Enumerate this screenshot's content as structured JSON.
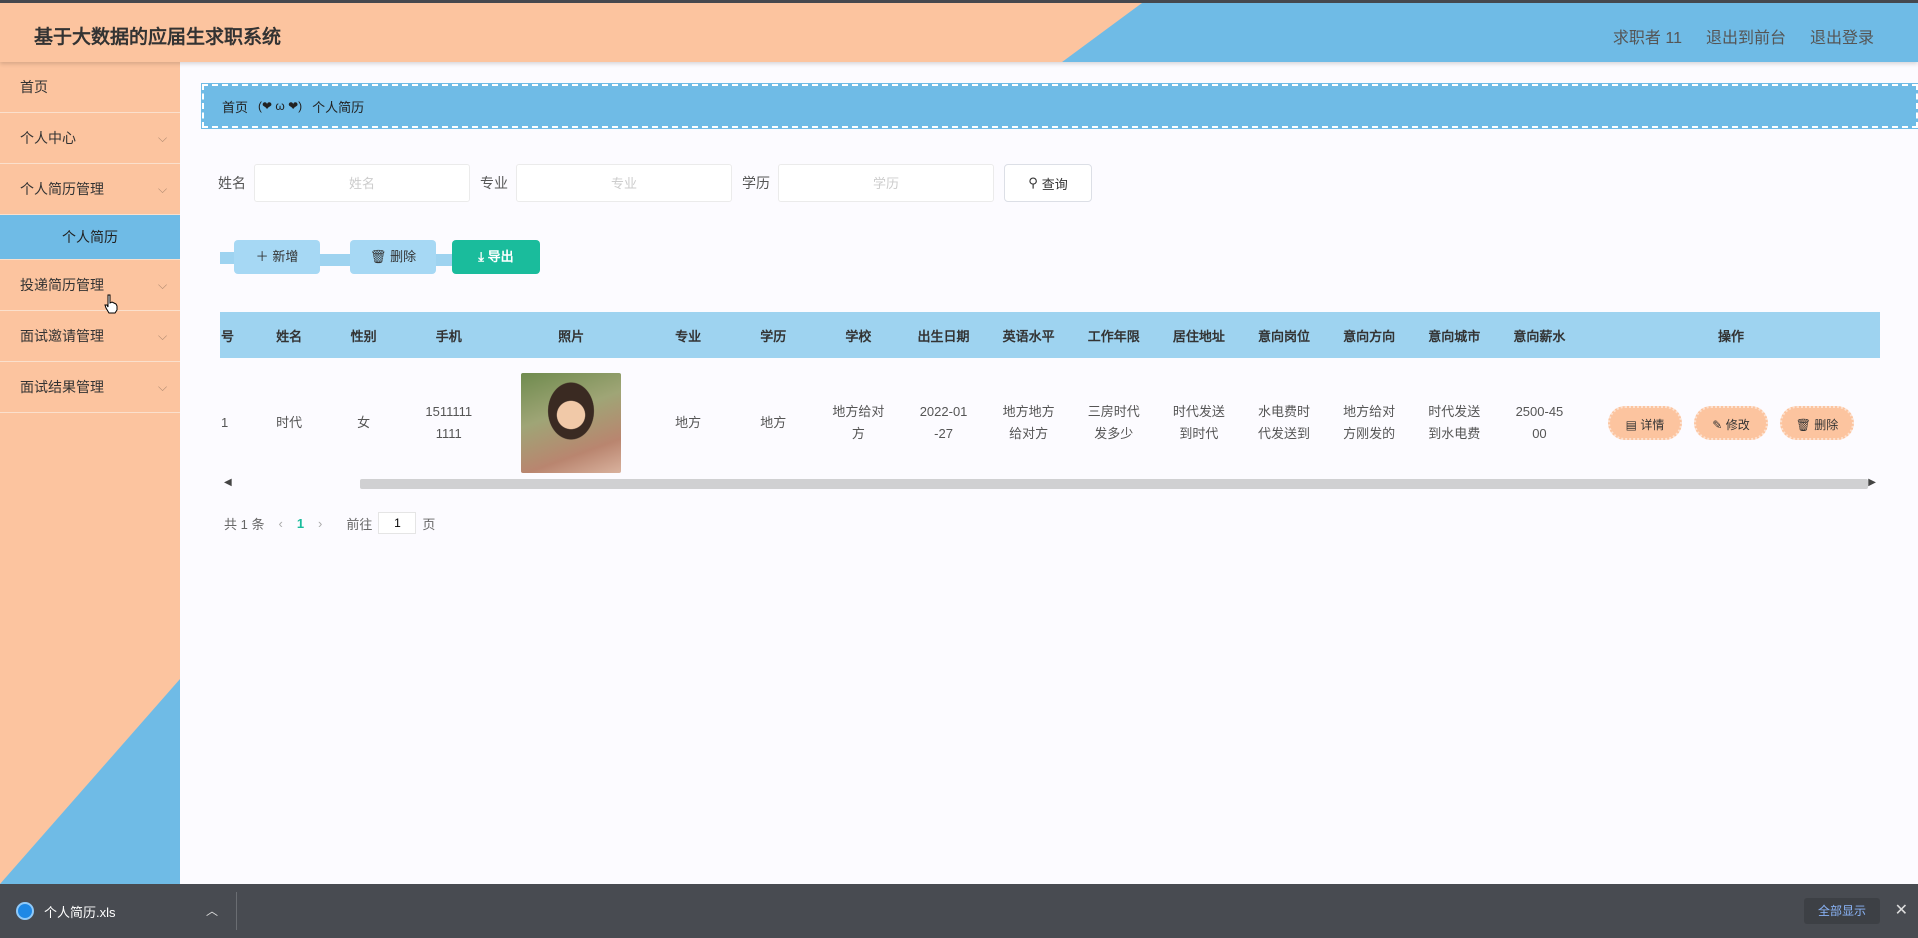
{
  "app": {
    "title": "基于大数据的应届生求职系统"
  },
  "header": {
    "user": "求职者 11",
    "to_front": "退出到前台",
    "logout": "退出登录"
  },
  "sidebar": {
    "items": [
      {
        "label": "首页"
      },
      {
        "label": "个人中心"
      },
      {
        "label": "个人简历管理"
      },
      {
        "label": "个人简历"
      },
      {
        "label": "投递简历管理"
      },
      {
        "label": "面试邀请管理"
      },
      {
        "label": "面试结果管理"
      }
    ]
  },
  "breadcrumb": {
    "home": "首页",
    "sep": "(❤ ω ❤)",
    "current": "个人简历"
  },
  "search": {
    "name_label": "姓名",
    "name_placeholder": "姓名",
    "major_label": "专业",
    "major_placeholder": "专业",
    "edu_label": "学历",
    "edu_placeholder": "学历",
    "query": "查询"
  },
  "actions": {
    "add": "新增",
    "delete": "删除",
    "export": "导出"
  },
  "table": {
    "headers": [
      "号",
      "姓名",
      "性别",
      "手机",
      "照片",
      "专业",
      "学历",
      "学校",
      "出生日期",
      "英语水平",
      "工作年限",
      "居住地址",
      "意向岗位",
      "意向方向",
      "意向城市",
      "意向薪水",
      "操作"
    ],
    "row": {
      "no": "1",
      "name": "时代",
      "gender": "女",
      "phone": "1511111 1111",
      "major": "地方",
      "edu": "地方",
      "school": "地方给对 方",
      "birth": "2022-01 -27",
      "english": "地方地方 给对方",
      "years": "三房时代 发多少",
      "address": "时代发送 到时代",
      "job": "水电费时 代发送到",
      "direction": "地方给对 方刚发的",
      "city": "时代发送 到水电费",
      "salary": "2500-45 00"
    },
    "ops": {
      "detail": "详情",
      "edit": "修改",
      "delete": "删除"
    }
  },
  "pager": {
    "total": "共 1 条",
    "current": "1",
    "goto": "前往",
    "page_input": "1",
    "page_unit": "页"
  },
  "download": {
    "filename": "个人简历.xls",
    "show_all": "全部显示"
  },
  "colors": {
    "peach": "#fcc49f",
    "blue": "#6fbbe6",
    "teal": "#1abc9c"
  }
}
